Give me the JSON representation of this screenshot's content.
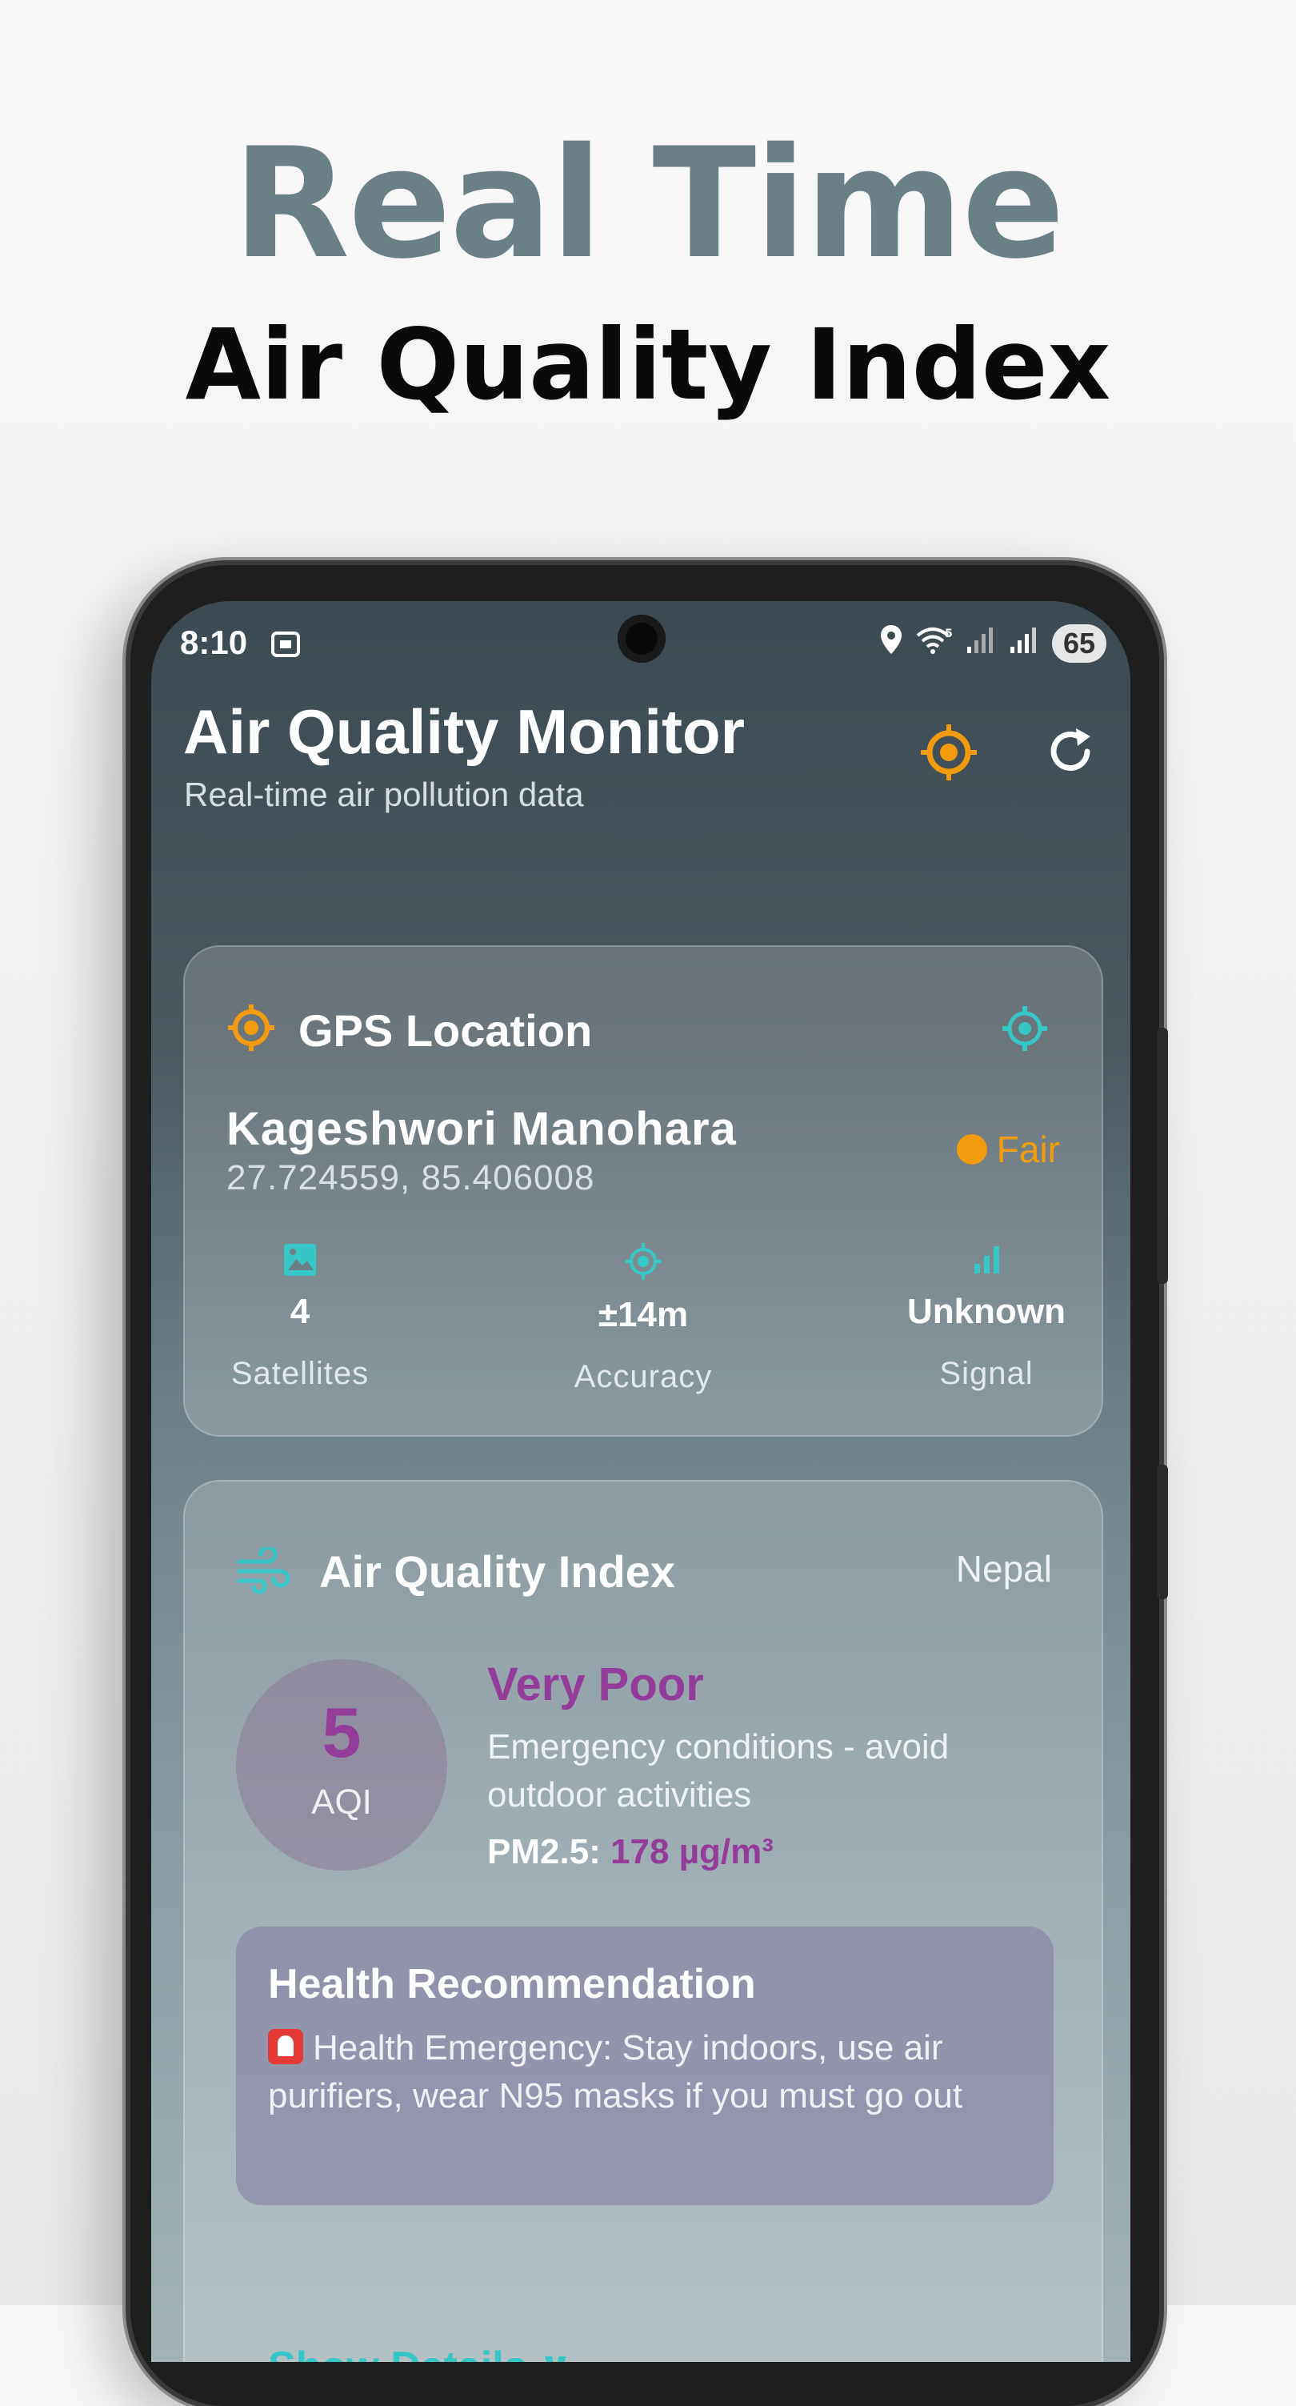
{
  "hero": {
    "title": "Real Time",
    "subtitle": "Air Quality Index"
  },
  "status_bar": {
    "time": "8:10",
    "battery": "65"
  },
  "header": {
    "title": "Air Quality Monitor",
    "subtitle": "Real-time air pollution data"
  },
  "gps_card": {
    "title": "GPS Location",
    "location_name": "Kageshwori Manohara",
    "coordinates": "27.724559, 85.406008",
    "fix_quality": "Fair",
    "stats": [
      {
        "value": "4",
        "label": "Satellites"
      },
      {
        "value": "±14m",
        "label": "Accuracy"
      },
      {
        "value": "Unknown",
        "label": "Signal"
      }
    ]
  },
  "aqi_card": {
    "title": "Air Quality Index",
    "region": "Nepal",
    "aqi_value": "5",
    "aqi_unit": "AQI",
    "level": "Very Poor",
    "description": "Emergency conditions - avoid outdoor activities",
    "pm_label": "PM2.5:",
    "pm_value": "178 µg/m³",
    "health": {
      "title": "Health Recommendation",
      "text": "Health Emergency: Stay indoors, use air purifiers, wear N95 masks if you must go out"
    },
    "show_details": "Show Details ∨"
  },
  "colors": {
    "accent_orange": "#f29b0d",
    "accent_teal": "#37c6c6",
    "very_poor_purple": "#943c9a"
  }
}
